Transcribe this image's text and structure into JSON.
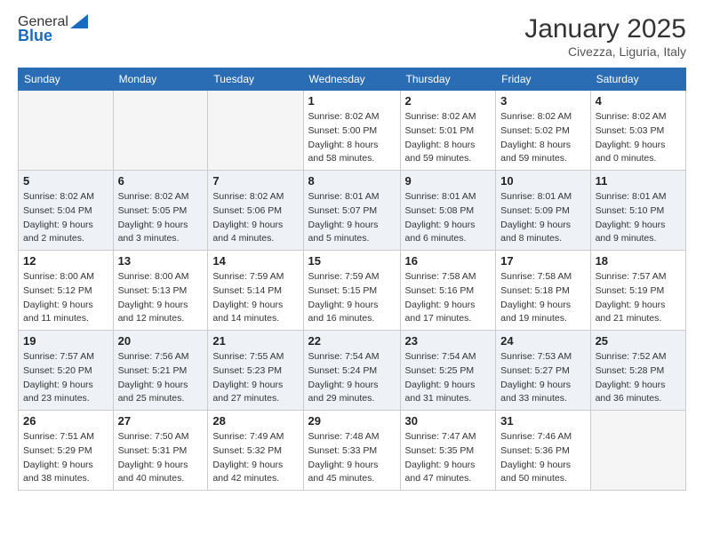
{
  "logo": {
    "general": "General",
    "blue": "Blue"
  },
  "title": "January 2025",
  "location": "Civezza, Liguria, Italy",
  "days_of_week": [
    "Sunday",
    "Monday",
    "Tuesday",
    "Wednesday",
    "Thursday",
    "Friday",
    "Saturday"
  ],
  "weeks": [
    [
      {
        "num": "",
        "info": ""
      },
      {
        "num": "",
        "info": ""
      },
      {
        "num": "",
        "info": ""
      },
      {
        "num": "1",
        "info": "Sunrise: 8:02 AM\nSunset: 5:00 PM\nDaylight: 8 hours\nand 58 minutes."
      },
      {
        "num": "2",
        "info": "Sunrise: 8:02 AM\nSunset: 5:01 PM\nDaylight: 8 hours\nand 59 minutes."
      },
      {
        "num": "3",
        "info": "Sunrise: 8:02 AM\nSunset: 5:02 PM\nDaylight: 8 hours\nand 59 minutes."
      },
      {
        "num": "4",
        "info": "Sunrise: 8:02 AM\nSunset: 5:03 PM\nDaylight: 9 hours\nand 0 minutes."
      }
    ],
    [
      {
        "num": "5",
        "info": "Sunrise: 8:02 AM\nSunset: 5:04 PM\nDaylight: 9 hours\nand 2 minutes."
      },
      {
        "num": "6",
        "info": "Sunrise: 8:02 AM\nSunset: 5:05 PM\nDaylight: 9 hours\nand 3 minutes."
      },
      {
        "num": "7",
        "info": "Sunrise: 8:02 AM\nSunset: 5:06 PM\nDaylight: 9 hours\nand 4 minutes."
      },
      {
        "num": "8",
        "info": "Sunrise: 8:01 AM\nSunset: 5:07 PM\nDaylight: 9 hours\nand 5 minutes."
      },
      {
        "num": "9",
        "info": "Sunrise: 8:01 AM\nSunset: 5:08 PM\nDaylight: 9 hours\nand 6 minutes."
      },
      {
        "num": "10",
        "info": "Sunrise: 8:01 AM\nSunset: 5:09 PM\nDaylight: 9 hours\nand 8 minutes."
      },
      {
        "num": "11",
        "info": "Sunrise: 8:01 AM\nSunset: 5:10 PM\nDaylight: 9 hours\nand 9 minutes."
      }
    ],
    [
      {
        "num": "12",
        "info": "Sunrise: 8:00 AM\nSunset: 5:12 PM\nDaylight: 9 hours\nand 11 minutes."
      },
      {
        "num": "13",
        "info": "Sunrise: 8:00 AM\nSunset: 5:13 PM\nDaylight: 9 hours\nand 12 minutes."
      },
      {
        "num": "14",
        "info": "Sunrise: 7:59 AM\nSunset: 5:14 PM\nDaylight: 9 hours\nand 14 minutes."
      },
      {
        "num": "15",
        "info": "Sunrise: 7:59 AM\nSunset: 5:15 PM\nDaylight: 9 hours\nand 16 minutes."
      },
      {
        "num": "16",
        "info": "Sunrise: 7:58 AM\nSunset: 5:16 PM\nDaylight: 9 hours\nand 17 minutes."
      },
      {
        "num": "17",
        "info": "Sunrise: 7:58 AM\nSunset: 5:18 PM\nDaylight: 9 hours\nand 19 minutes."
      },
      {
        "num": "18",
        "info": "Sunrise: 7:57 AM\nSunset: 5:19 PM\nDaylight: 9 hours\nand 21 minutes."
      }
    ],
    [
      {
        "num": "19",
        "info": "Sunrise: 7:57 AM\nSunset: 5:20 PM\nDaylight: 9 hours\nand 23 minutes."
      },
      {
        "num": "20",
        "info": "Sunrise: 7:56 AM\nSunset: 5:21 PM\nDaylight: 9 hours\nand 25 minutes."
      },
      {
        "num": "21",
        "info": "Sunrise: 7:55 AM\nSunset: 5:23 PM\nDaylight: 9 hours\nand 27 minutes."
      },
      {
        "num": "22",
        "info": "Sunrise: 7:54 AM\nSunset: 5:24 PM\nDaylight: 9 hours\nand 29 minutes."
      },
      {
        "num": "23",
        "info": "Sunrise: 7:54 AM\nSunset: 5:25 PM\nDaylight: 9 hours\nand 31 minutes."
      },
      {
        "num": "24",
        "info": "Sunrise: 7:53 AM\nSunset: 5:27 PM\nDaylight: 9 hours\nand 33 minutes."
      },
      {
        "num": "25",
        "info": "Sunrise: 7:52 AM\nSunset: 5:28 PM\nDaylight: 9 hours\nand 36 minutes."
      }
    ],
    [
      {
        "num": "26",
        "info": "Sunrise: 7:51 AM\nSunset: 5:29 PM\nDaylight: 9 hours\nand 38 minutes."
      },
      {
        "num": "27",
        "info": "Sunrise: 7:50 AM\nSunset: 5:31 PM\nDaylight: 9 hours\nand 40 minutes."
      },
      {
        "num": "28",
        "info": "Sunrise: 7:49 AM\nSunset: 5:32 PM\nDaylight: 9 hours\nand 42 minutes."
      },
      {
        "num": "29",
        "info": "Sunrise: 7:48 AM\nSunset: 5:33 PM\nDaylight: 9 hours\nand 45 minutes."
      },
      {
        "num": "30",
        "info": "Sunrise: 7:47 AM\nSunset: 5:35 PM\nDaylight: 9 hours\nand 47 minutes."
      },
      {
        "num": "31",
        "info": "Sunrise: 7:46 AM\nSunset: 5:36 PM\nDaylight: 9 hours\nand 50 minutes."
      },
      {
        "num": "",
        "info": ""
      }
    ]
  ]
}
